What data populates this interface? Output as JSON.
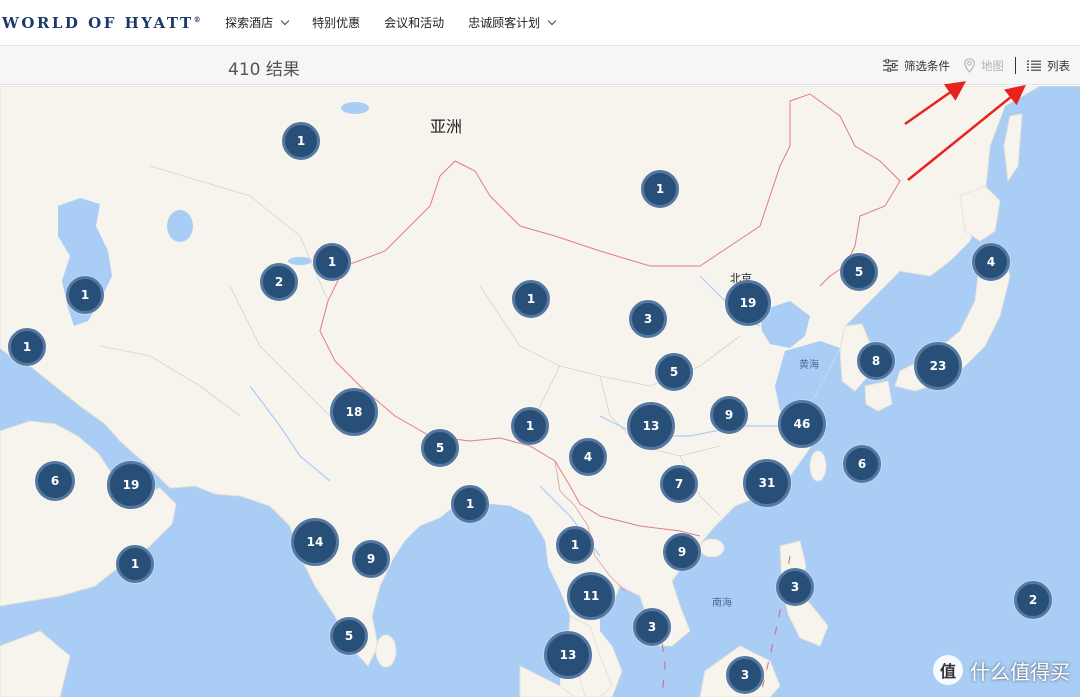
{
  "nav": {
    "logo": "WORLD OF HYATT",
    "logo_mark": "®",
    "items": [
      {
        "label": "探索酒店",
        "dropdown": true
      },
      {
        "label": "特别优惠",
        "dropdown": false
      },
      {
        "label": "会议和活动",
        "dropdown": false
      },
      {
        "label": "忠诚顾客计划",
        "dropdown": true
      }
    ]
  },
  "results_bar": {
    "count_label": "410 结果",
    "filter_label": "筛选条件",
    "map_label": "地图",
    "list_label": "列表"
  },
  "map": {
    "labels": {
      "continent": "亚洲",
      "beijing": "北京",
      "yellow_sea": "黄海",
      "south_china_sea": "南海"
    },
    "clusters": [
      {
        "id": "kazakhstan-north",
        "count": "1"
      },
      {
        "id": "mongolia",
        "count": "1"
      },
      {
        "id": "caspian",
        "count": "1"
      },
      {
        "id": "uzbekistan",
        "count": "2"
      },
      {
        "id": "kazakhstan-south",
        "count": "1"
      },
      {
        "id": "xinjiang",
        "count": "1"
      },
      {
        "id": "qinghai",
        "count": "3"
      },
      {
        "id": "beijing",
        "count": "19"
      },
      {
        "id": "korea",
        "count": "5"
      },
      {
        "id": "hokkaido",
        "count": "4"
      },
      {
        "id": "iran",
        "count": "1"
      },
      {
        "id": "shanghai-north",
        "count": "5"
      },
      {
        "id": "kyushu",
        "count": "8"
      },
      {
        "id": "tokyo",
        "count": "23"
      },
      {
        "id": "delhi",
        "count": "18"
      },
      {
        "id": "tibet",
        "count": "1"
      },
      {
        "id": "sichuan",
        "count": "13"
      },
      {
        "id": "hubei",
        "count": "9"
      },
      {
        "id": "shanghai",
        "count": "46"
      },
      {
        "id": "nepal",
        "count": "5"
      },
      {
        "id": "yunnan",
        "count": "4"
      },
      {
        "id": "arabia",
        "count": "6"
      },
      {
        "id": "uae",
        "count": "19"
      },
      {
        "id": "guangxi",
        "count": "7"
      },
      {
        "id": "hongkong",
        "count": "31"
      },
      {
        "id": "taiwan",
        "count": "6"
      },
      {
        "id": "kolkata",
        "count": "1"
      },
      {
        "id": "mumbai",
        "count": "14"
      },
      {
        "id": "hyderabad",
        "count": "9"
      },
      {
        "id": "myanmar",
        "count": "1"
      },
      {
        "id": "vietnam",
        "count": "9"
      },
      {
        "id": "oman",
        "count": "1"
      },
      {
        "id": "bangkok",
        "count": "11"
      },
      {
        "id": "philippines",
        "count": "3"
      },
      {
        "id": "guam",
        "count": "2"
      },
      {
        "id": "srilanka",
        "count": "5"
      },
      {
        "id": "malaysia-east",
        "count": "3"
      },
      {
        "id": "malaysia",
        "count": "13"
      },
      {
        "id": "borneo",
        "count": "3"
      }
    ]
  },
  "watermark": {
    "icon": "值",
    "text": "什么值得买"
  },
  "colors": {
    "land": "#f7f4ee",
    "water": "#a9cdf4",
    "cluster": "#284f78",
    "cluster_ring": "#5578a0",
    "brand": "#1b3a6b",
    "border": "#d95d71",
    "annotation_arrow": "#e8231e"
  }
}
